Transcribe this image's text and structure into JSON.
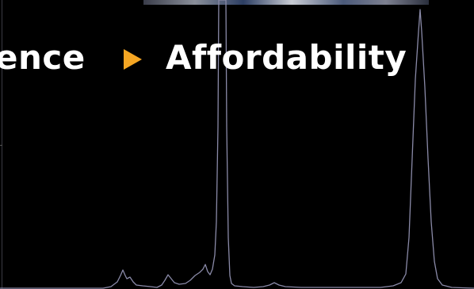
{
  "headline": {
    "left_word": "ence",
    "separator_icon": "play-arrow-icon",
    "right_word": "Affordability"
  },
  "colors": {
    "background": "#000000",
    "text": "#ffffff",
    "arrow_accent": "#f5a623",
    "trace_line": "#8a8aa8"
  }
}
